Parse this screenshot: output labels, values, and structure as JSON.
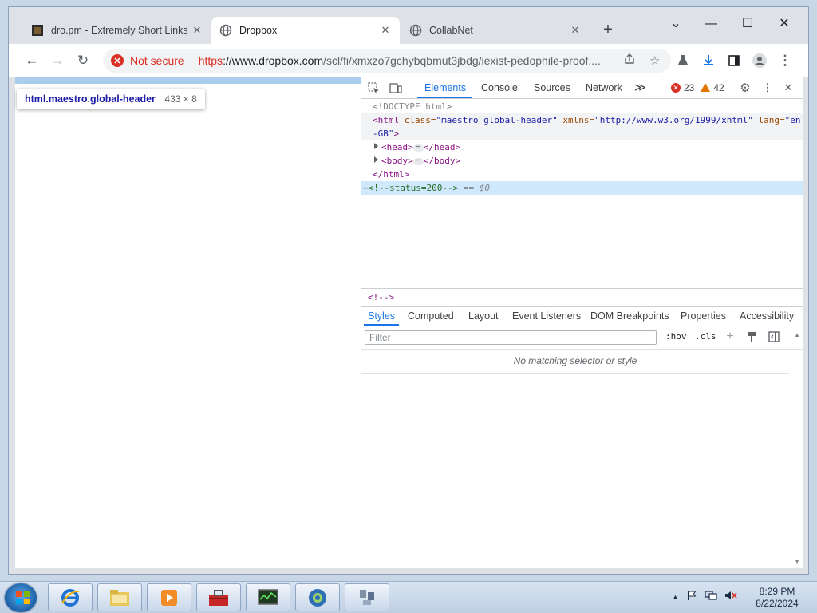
{
  "browser": {
    "tabs": [
      {
        "title": "dro.pm - Extremely Short Links",
        "close": "✕",
        "active": false,
        "favicon": "dropm-favicon"
      },
      {
        "title": "Dropbox",
        "close": "✕",
        "active": true,
        "favicon": "globe-icon"
      },
      {
        "title": "CollabNet",
        "close": "✕",
        "active": false,
        "favicon": "globe-icon"
      }
    ],
    "new_tab": "+",
    "window_controls": {
      "tab_search": "⌄",
      "minimize": "—",
      "maximize": "☐",
      "close": "✕"
    },
    "toolbar": {
      "back": "←",
      "forward": "→",
      "reload": "↻"
    },
    "omnibox": {
      "security_label": "Not secure",
      "url_scheme": "https",
      "url_host": "://www.dropbox.com",
      "url_path": "/scl/fi/xmxzo7gchybqbmut3jbdg/iexist-pedophile-proof...."
    }
  },
  "page": {
    "tooltip_selector": "html.maestro.global-header",
    "tooltip_size": "433 × 8"
  },
  "devtools": {
    "tabs": [
      "Elements",
      "Console",
      "Sources",
      "Network"
    ],
    "more_tabs": "≫",
    "errors": "23",
    "warnings": "42",
    "code": {
      "doctype": "<!DOCTYPE html>",
      "html_open_tag": "<html",
      "class_attr": " class=",
      "class_val": "\"maestro global-header\"",
      "xmlns_attr": " xmlns=",
      "xmlns_val": "\"http://www.w3.org/1999/xhtml\"",
      "lang_attr": " lang=",
      "lang_val_a": "\"en",
      "lang_val_b": "-GB\"",
      "gt": ">",
      "head_open": "<head>",
      "head_close": "</head>",
      "body_open": "<body>",
      "body_close": "</body>",
      "html_close": "</html>",
      "comment": "<!--status=200-->",
      "eq": " == ",
      "dollar": "$0",
      "ellipsis": "⋯"
    },
    "breadcrumb": "<!-->",
    "sub_tabs": [
      "Styles",
      "Computed",
      "Layout",
      "Event Listeners",
      "DOM Breakpoints",
      "Properties",
      "Accessibility"
    ],
    "filter_placeholder": "Filter",
    "hov": ":hov",
    "cls": ".cls",
    "no_match": "No matching selector or style"
  },
  "taskbar": {
    "time": "8:29 PM",
    "date": "8/22/2024"
  },
  "colors": {
    "accent": "#1a73e8",
    "danger": "#d93025",
    "warning": "#e37400"
  }
}
